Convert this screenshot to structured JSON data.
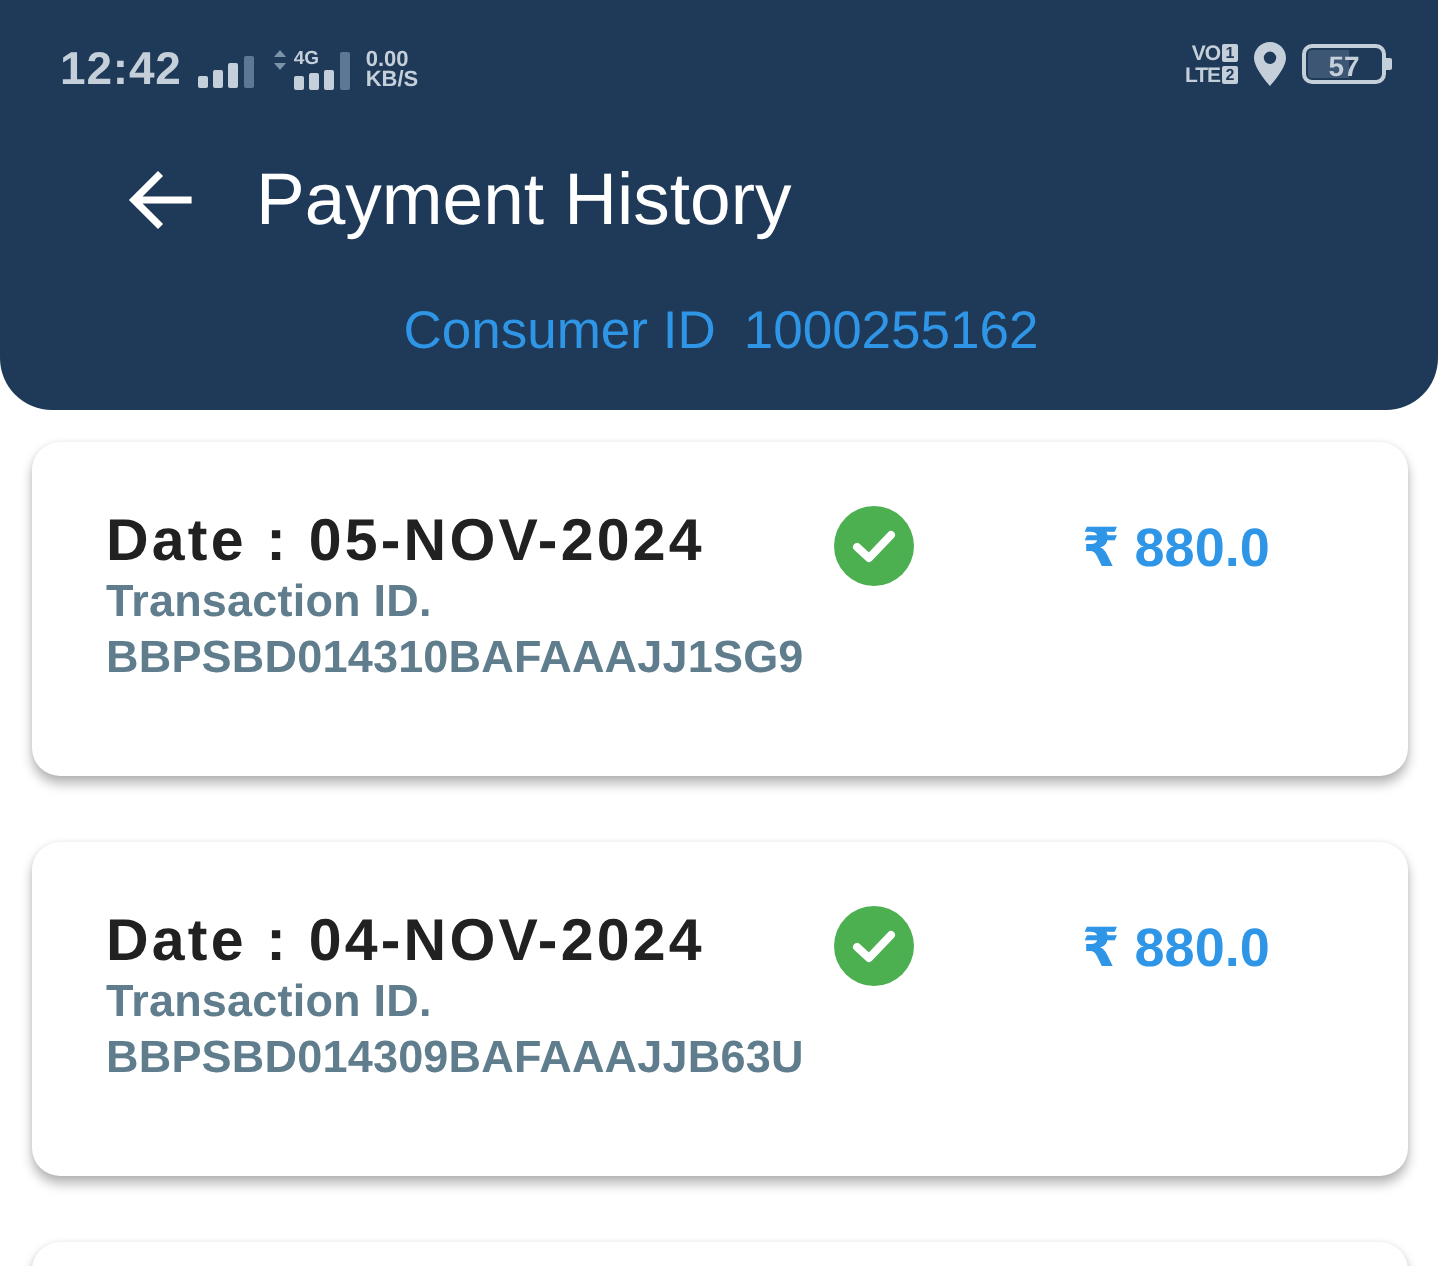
{
  "status_bar": {
    "time": "12:42",
    "network_type": "4G",
    "data_speed": "0.00",
    "data_speed_unit": "KB/S",
    "volte": [
      {
        "label": "VO",
        "sim": "1"
      },
      {
        "label": "LTE",
        "sim": "2"
      }
    ],
    "battery": "57"
  },
  "app_bar": {
    "title": "Payment History",
    "consumer_id_label": "Consumer ID",
    "consumer_id": "1000255162"
  },
  "transactions": [
    {
      "date": "Date : 05-NOV-2024",
      "paid": true,
      "amount": "₹ 880.0",
      "id_label": "Transaction ID.",
      "id": "BBPSBD014310BAFAAAJJ1SG9"
    },
    {
      "date": "Date : 04-NOV-2024",
      "paid": true,
      "amount": "₹ 880.0",
      "id_label": "Transaction ID.",
      "id": "BBPSBD014309BAFAAAJJB63U"
    }
  ]
}
